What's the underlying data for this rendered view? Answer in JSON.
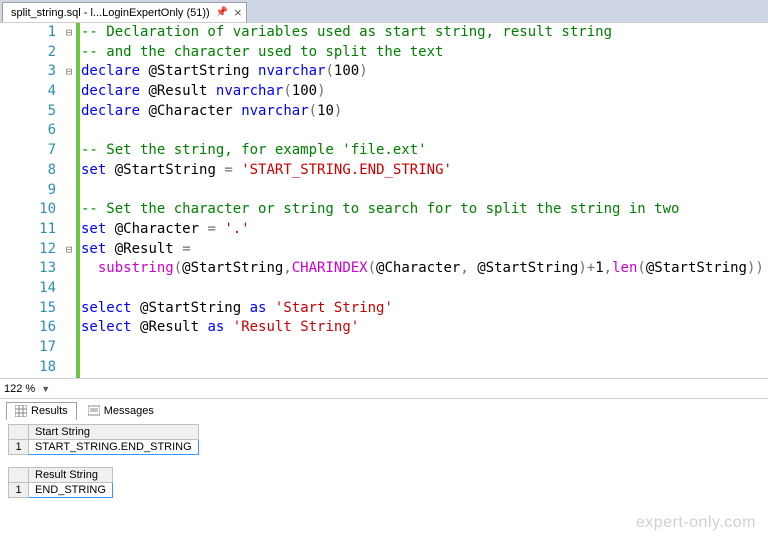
{
  "tab": {
    "title": "split_string.sql - l...LoginExpertOnly (51))"
  },
  "zoom": "122 %",
  "lines": [
    [
      {
        "c": "c-com",
        "t": "-- Declaration of variables used as start string, result string"
      }
    ],
    [
      {
        "c": "c-com",
        "t": "-- and the character used to split the text"
      }
    ],
    [
      {
        "c": "c-kw",
        "t": "declare"
      },
      {
        "c": "",
        "t": " "
      },
      {
        "c": "c-var",
        "t": "@StartString"
      },
      {
        "c": "",
        "t": " "
      },
      {
        "c": "c-type",
        "t": "nvarchar"
      },
      {
        "c": "c-par",
        "t": "("
      },
      {
        "c": "c-num",
        "t": "100"
      },
      {
        "c": "c-par",
        "t": ")"
      }
    ],
    [
      {
        "c": "c-kw",
        "t": "declare"
      },
      {
        "c": "",
        "t": " "
      },
      {
        "c": "c-var",
        "t": "@Result"
      },
      {
        "c": "",
        "t": " "
      },
      {
        "c": "c-type",
        "t": "nvarchar"
      },
      {
        "c": "c-par",
        "t": "("
      },
      {
        "c": "c-num",
        "t": "100"
      },
      {
        "c": "c-par",
        "t": ")"
      }
    ],
    [
      {
        "c": "c-kw",
        "t": "declare"
      },
      {
        "c": "",
        "t": " "
      },
      {
        "c": "c-var",
        "t": "@Character"
      },
      {
        "c": "",
        "t": " "
      },
      {
        "c": "c-type",
        "t": "nvarchar"
      },
      {
        "c": "c-par",
        "t": "("
      },
      {
        "c": "c-num",
        "t": "10"
      },
      {
        "c": "c-par",
        "t": ")"
      }
    ],
    [],
    [
      {
        "c": "c-com",
        "t": "-- Set the string, for example 'file.ext'"
      }
    ],
    [
      {
        "c": "c-kw",
        "t": "set"
      },
      {
        "c": "",
        "t": " "
      },
      {
        "c": "c-var",
        "t": "@StartString"
      },
      {
        "c": "",
        "t": " "
      },
      {
        "c": "c-par",
        "t": "="
      },
      {
        "c": "",
        "t": " "
      },
      {
        "c": "c-str",
        "t": "'START_STRING.END_STRING'"
      }
    ],
    [],
    [
      {
        "c": "c-com",
        "t": "-- Set the character or string to search for to split the string in two"
      }
    ],
    [
      {
        "c": "c-kw",
        "t": "set"
      },
      {
        "c": "",
        "t": " "
      },
      {
        "c": "c-var",
        "t": "@Character"
      },
      {
        "c": "",
        "t": " "
      },
      {
        "c": "c-par",
        "t": "="
      },
      {
        "c": "",
        "t": " "
      },
      {
        "c": "c-str",
        "t": "'.'"
      }
    ],
    [
      {
        "c": "c-kw",
        "t": "set"
      },
      {
        "c": "",
        "t": " "
      },
      {
        "c": "c-var",
        "t": "@Result"
      },
      {
        "c": "",
        "t": " "
      },
      {
        "c": "c-par",
        "t": "="
      }
    ],
    [
      {
        "c": "",
        "t": "  "
      },
      {
        "c": "c-func",
        "t": "substring"
      },
      {
        "c": "c-par",
        "t": "("
      },
      {
        "c": "c-var",
        "t": "@StartString"
      },
      {
        "c": "c-par",
        "t": ","
      },
      {
        "c": "c-func",
        "t": "CHARINDEX"
      },
      {
        "c": "c-par",
        "t": "("
      },
      {
        "c": "c-var",
        "t": "@Character"
      },
      {
        "c": "c-par",
        "t": ","
      },
      {
        "c": "",
        "t": " "
      },
      {
        "c": "c-var",
        "t": "@StartString"
      },
      {
        "c": "c-par",
        "t": ")+"
      },
      {
        "c": "c-num",
        "t": "1"
      },
      {
        "c": "c-par",
        "t": ","
      },
      {
        "c": "c-func",
        "t": "len"
      },
      {
        "c": "c-par",
        "t": "("
      },
      {
        "c": "c-var",
        "t": "@StartString"
      },
      {
        "c": "c-par",
        "t": "))"
      }
    ],
    [],
    [
      {
        "c": "c-kw",
        "t": "select"
      },
      {
        "c": "",
        "t": " "
      },
      {
        "c": "c-var",
        "t": "@StartString"
      },
      {
        "c": "",
        "t": " "
      },
      {
        "c": "c-kw",
        "t": "as"
      },
      {
        "c": "",
        "t": " "
      },
      {
        "c": "c-str",
        "t": "'Start String'"
      }
    ],
    [
      {
        "c": "c-kw",
        "t": "select"
      },
      {
        "c": "",
        "t": " "
      },
      {
        "c": "c-var",
        "t": "@Result"
      },
      {
        "c": "",
        "t": " "
      },
      {
        "c": "c-kw",
        "t": "as"
      },
      {
        "c": "",
        "t": " "
      },
      {
        "c": "c-str",
        "t": "'Result String'"
      }
    ],
    [],
    []
  ],
  "fold": {
    "1": "⊟",
    "3": "⊟",
    "12": "⊟"
  },
  "resultsTabs": {
    "results": "Results",
    "messages": "Messages"
  },
  "grids": [
    {
      "header": "Start String",
      "row": "1",
      "value": "START_STRING.END_STRING"
    },
    {
      "header": "Result String",
      "row": "1",
      "value": "END_STRING"
    }
  ],
  "watermark": "expert-only.com"
}
